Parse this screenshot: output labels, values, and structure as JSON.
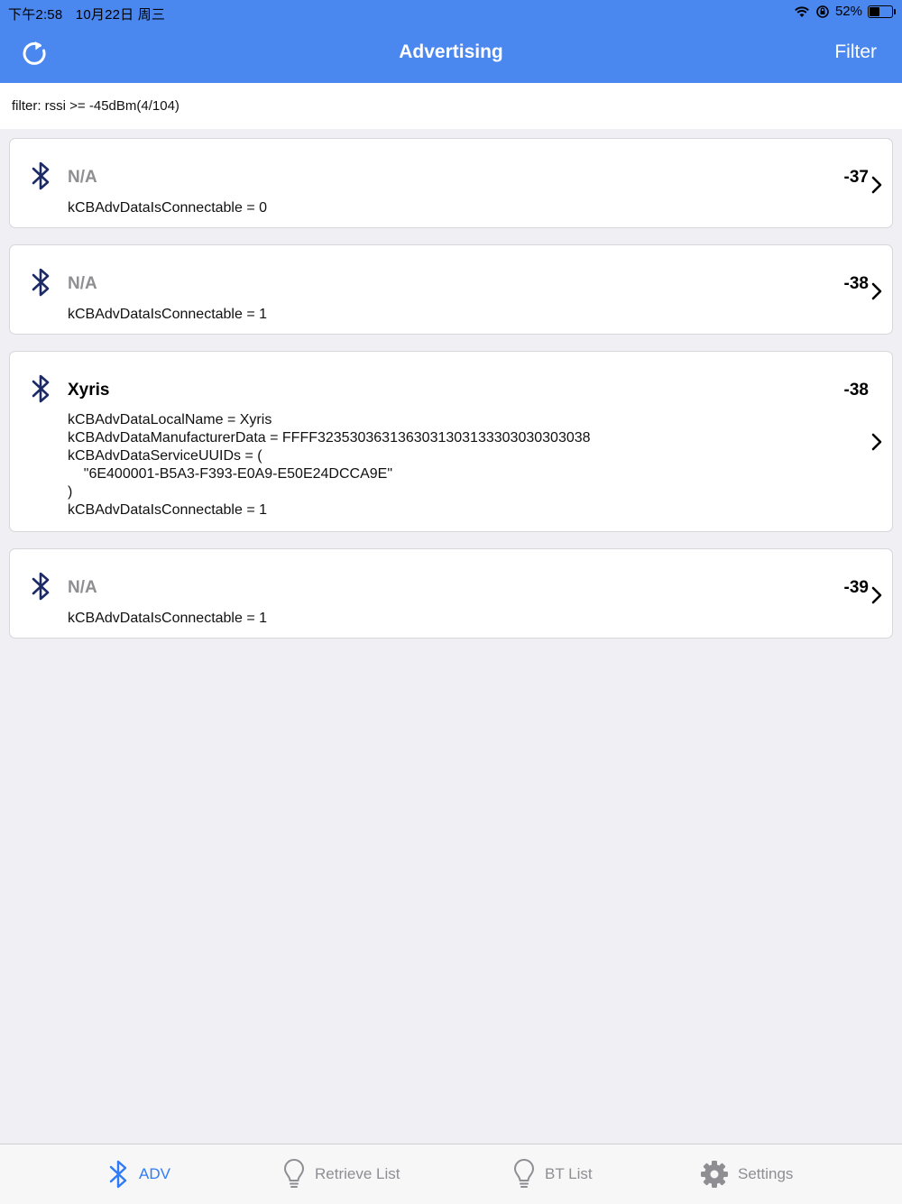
{
  "status_bar": {
    "time": "下午2:58",
    "date": "10月22日 周三",
    "battery": "52%",
    "battery_level": 0.52
  },
  "nav": {
    "title": "Advertising",
    "filter_label": "Filter",
    "refresh_icon": "refresh-icon"
  },
  "filter_text": "filter: rssi >= -45dBm(4/104)",
  "devices": [
    {
      "name": "N/A",
      "rssi": "-37",
      "details": "kCBAdvDataIsConnectable = 0"
    },
    {
      "name": "N/A",
      "rssi": "-38",
      "details": "kCBAdvDataIsConnectable = 1"
    },
    {
      "name": "Xyris",
      "rssi": "-38",
      "details": "kCBAdvDataLocalName = Xyris\nkCBAdvDataManufacturerData = FFFF3235303631363031303133303030303038\nkCBAdvDataServiceUUIDs = (\n    \"6E400001-B5A3-F393-E0A9-E50E24DCCA9E\"\n)\nkCBAdvDataIsConnectable = 1"
    },
    {
      "name": "N/A",
      "rssi": "-39",
      "details": "kCBAdvDataIsConnectable = 1"
    }
  ],
  "tabs": [
    {
      "label": "ADV",
      "icon": "bluetooth-icon",
      "active": true
    },
    {
      "label": "Retrieve List",
      "icon": "lightbulb-icon",
      "active": false
    },
    {
      "label": "BT List",
      "icon": "lightbulb-icon",
      "active": false
    },
    {
      "label": "Settings",
      "icon": "gear-icon",
      "active": false
    }
  ],
  "colors": {
    "nav_bg": "#4a87ee",
    "accent": "#2f7cf6",
    "bluetooth_icon": "#1c2a66",
    "placeholder_name": "#8e8e93"
  }
}
